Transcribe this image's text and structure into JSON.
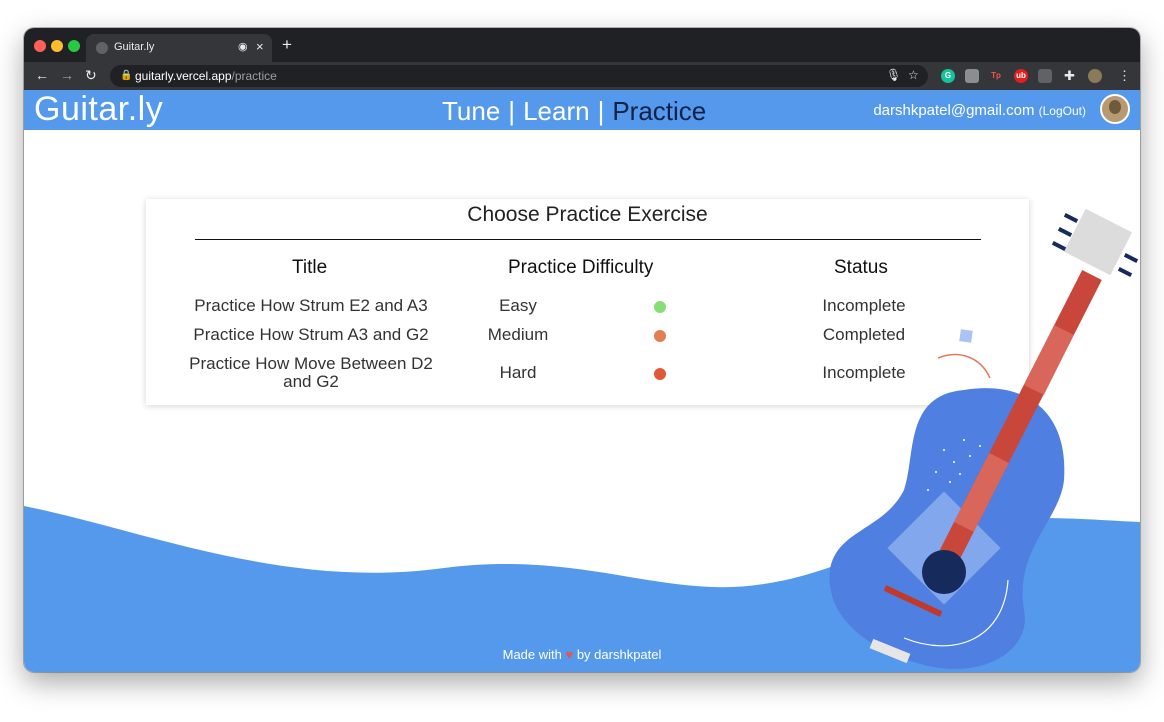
{
  "browser": {
    "tab_title": "Guitar.ly",
    "tab_close": "×",
    "new_tab": "+",
    "url_host": "guitarly.vercel.app",
    "url_path": "/practice"
  },
  "header": {
    "brand": "Guitar.ly",
    "nav": [
      "Tune",
      "Learn",
      "Practice"
    ],
    "separator": "|",
    "active": "Practice",
    "email": "darshkpatel@gmail.com",
    "logout_open": "(",
    "logout": "LogOut",
    "logout_close": ")"
  },
  "card": {
    "title": "Choose Practice Exercise",
    "headers": {
      "title": "Title",
      "difficulty": "Practice Difficulty",
      "status": "Status"
    },
    "rows": [
      {
        "title": "Practice How Strum E2 and A3",
        "difficulty": "Easy",
        "color": "#86de74",
        "status": "Incomplete"
      },
      {
        "title": "Practice How Strum A3 and G2",
        "difficulty": "Medium",
        "color": "#e08050",
        "status": "Completed"
      },
      {
        "title_line1": "Practice How Move Between D2",
        "title_line2": "and G2",
        "difficulty": "Hard",
        "color": "#e05a36",
        "status": "Incomplete"
      }
    ]
  },
  "footer": {
    "prefix": "Made with",
    "heart": "♥",
    "suffix": "by darshkpatel"
  },
  "colors": {
    "header": "#5599ec",
    "wave": "#5599ec",
    "active_nav": "#11224a"
  }
}
